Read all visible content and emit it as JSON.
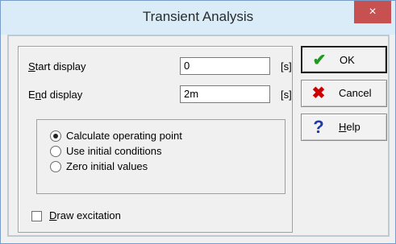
{
  "window": {
    "title": "Transient Analysis",
    "close_label": "×"
  },
  "fields": {
    "start_display": {
      "label_prefix": "",
      "label_hotkey": "S",
      "label_rest": "tart display",
      "value": "0",
      "unit": "[s]"
    },
    "end_display": {
      "label_prefix": "E",
      "label_hotkey": "n",
      "label_rest": "d display",
      "value": "2m",
      "unit": "[s]"
    }
  },
  "options": {
    "radios": [
      {
        "label": "Calculate operating point",
        "checked": true
      },
      {
        "label": "Use initial conditions",
        "checked": false
      },
      {
        "label": "Zero initial values",
        "checked": false
      }
    ],
    "draw_excitation": {
      "label_hotkey": "D",
      "label_rest": "raw excitation",
      "checked": false
    }
  },
  "buttons": {
    "ok": {
      "label": "OK",
      "icon": "checkmark-icon"
    },
    "cancel": {
      "label": "Cancel",
      "icon": "red-x-icon"
    },
    "help": {
      "label_hotkey": "H",
      "label_rest": "elp",
      "icon": "question-mark-icon"
    }
  },
  "colors": {
    "titlebar": "#d9ecf8",
    "close": "#c75050",
    "ok_check": "#1f9a1f",
    "cancel_x": "#cc0000",
    "help_q": "#1f3aa8"
  }
}
